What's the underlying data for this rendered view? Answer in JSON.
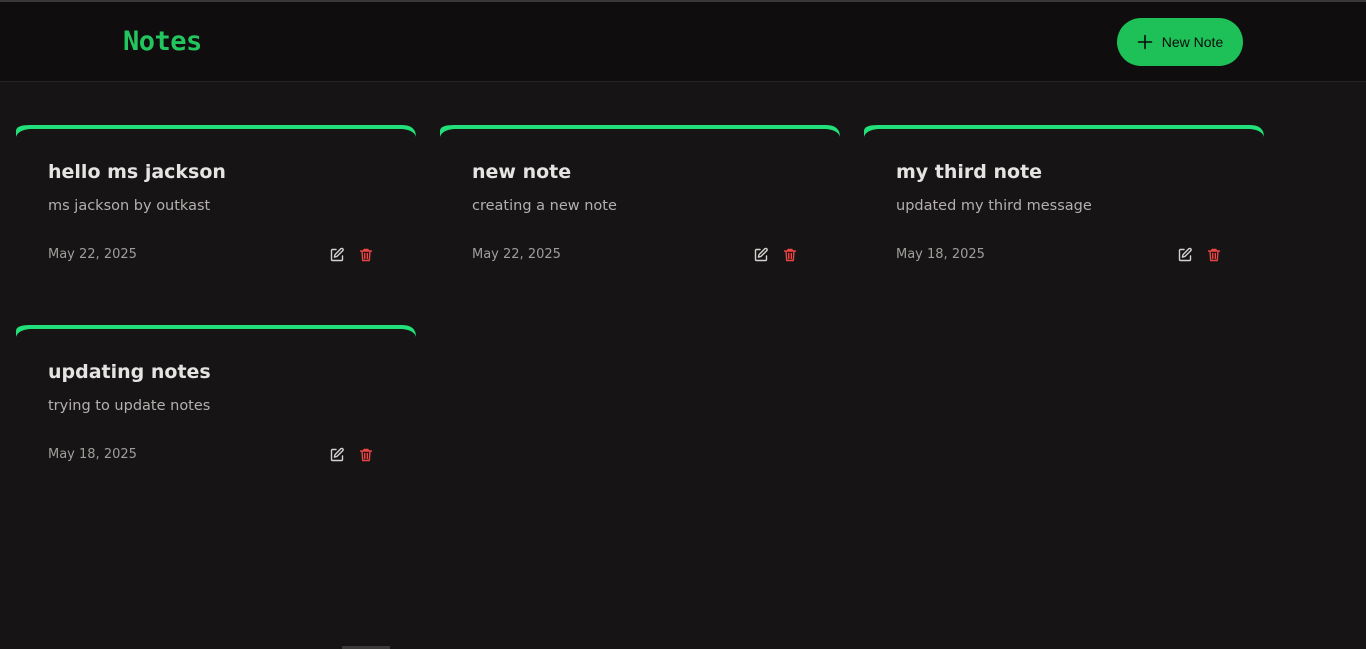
{
  "app": {
    "title": "Notes"
  },
  "header": {
    "new_note_label": "New Note",
    "new_note_icon": "plus-icon"
  },
  "colors": {
    "background": "#161414",
    "navbar": "#0f0d0d",
    "brand": "#22c55e",
    "button": "#1ec158",
    "accent": "#22e07a",
    "title_text": "#e6e3e3",
    "body_text": "#b4b0b0",
    "delete_icon": "#ef4444"
  },
  "notes": [
    {
      "title": "hello ms jackson",
      "content": "ms jackson by outkast",
      "date": "May 22, 2025"
    },
    {
      "title": "new note",
      "content": "creating a new note",
      "date": "May 22, 2025"
    },
    {
      "title": "my third note",
      "content": "updated my third message",
      "date": "May 18, 2025"
    },
    {
      "title": "updating notes",
      "content": "trying to update notes",
      "date": "May 18, 2025"
    }
  ],
  "card_icons": {
    "edit": "edit-icon",
    "delete": "trash-icon"
  }
}
